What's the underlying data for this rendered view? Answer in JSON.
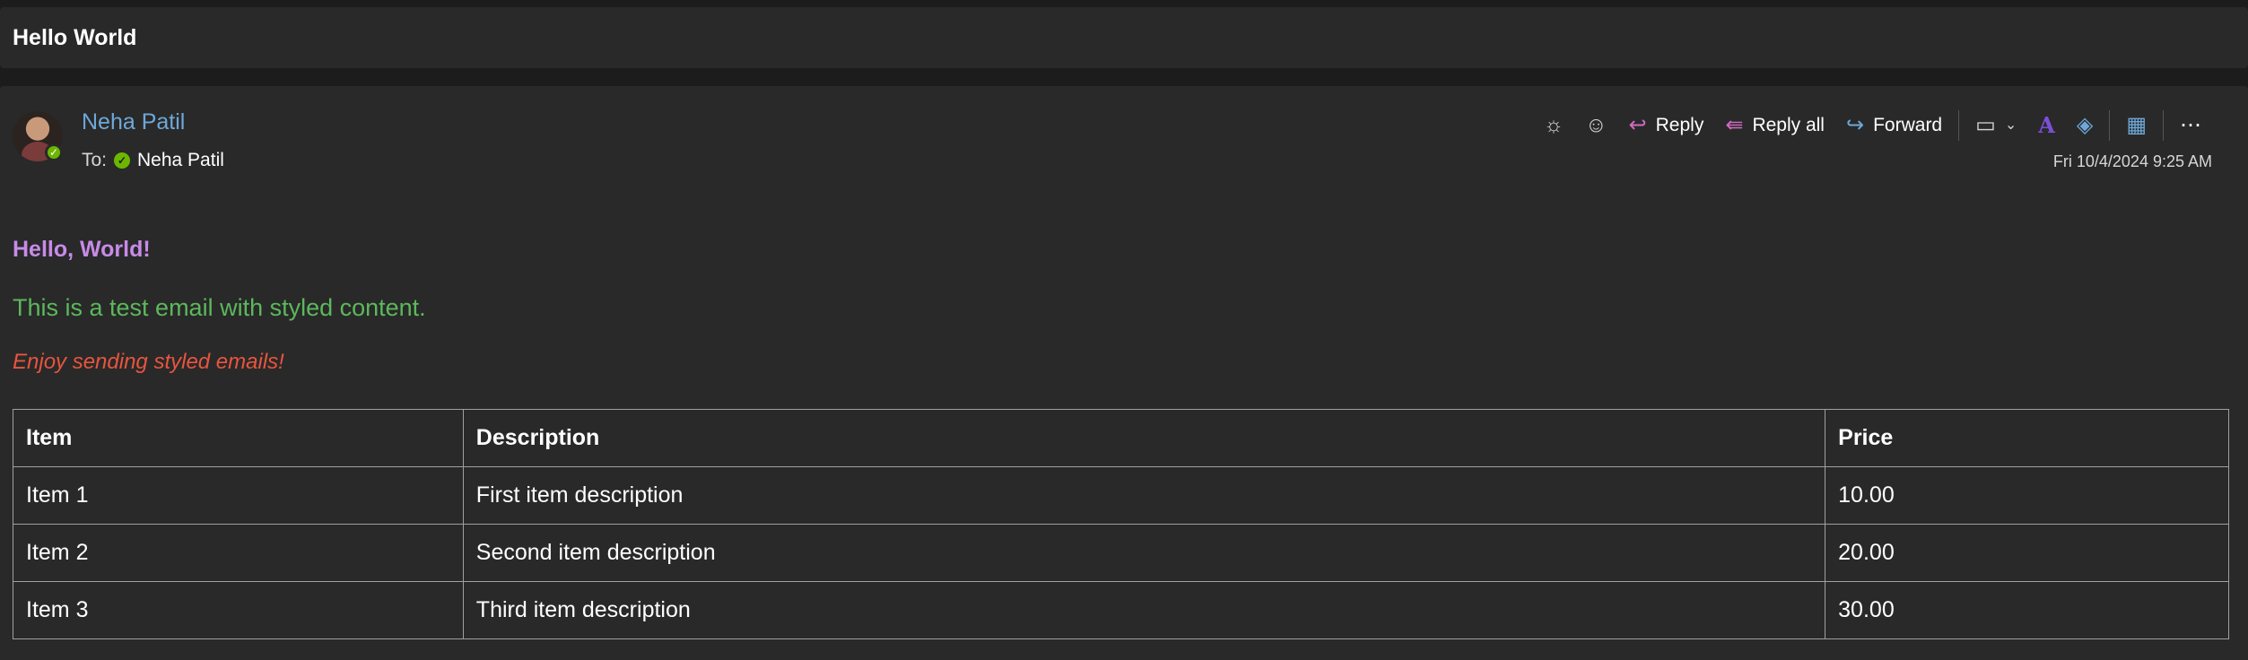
{
  "subject": "Hello World",
  "sender": {
    "name": "Neha Patil",
    "to_label": "To:",
    "recipient": "Neha Patil"
  },
  "toolbar": {
    "reply_label": "Reply",
    "reply_all_label": "Reply all",
    "forward_label": "Forward",
    "icons": [
      "brightness-icon",
      "emoji-icon",
      "reply-icon",
      "reply-all-icon",
      "forward-icon",
      "tag-icon",
      "chevron-down-icon",
      "editor-icon",
      "loop-icon",
      "apps-icon",
      "more-icon"
    ]
  },
  "date": "Fri 10/4/2024 9:25 AM",
  "body": {
    "greeting": "Hello, World!",
    "line1": "This is a test email with styled content.",
    "line2": "Enjoy sending styled emails!"
  },
  "table": {
    "headers": [
      "Item",
      "Description",
      "Price"
    ],
    "rows": [
      [
        "Item 1",
        "First item description",
        "10.00"
      ],
      [
        "Item 2",
        "Second item description",
        "20.00"
      ],
      [
        "Item 3",
        "Third item description",
        "30.00"
      ]
    ]
  },
  "colors": {
    "greeting": "#c88be8",
    "line1": "#5cb85c",
    "line2": "#e8553e",
    "sender_name": "#6ea8d8",
    "presence": "#6bb700"
  }
}
